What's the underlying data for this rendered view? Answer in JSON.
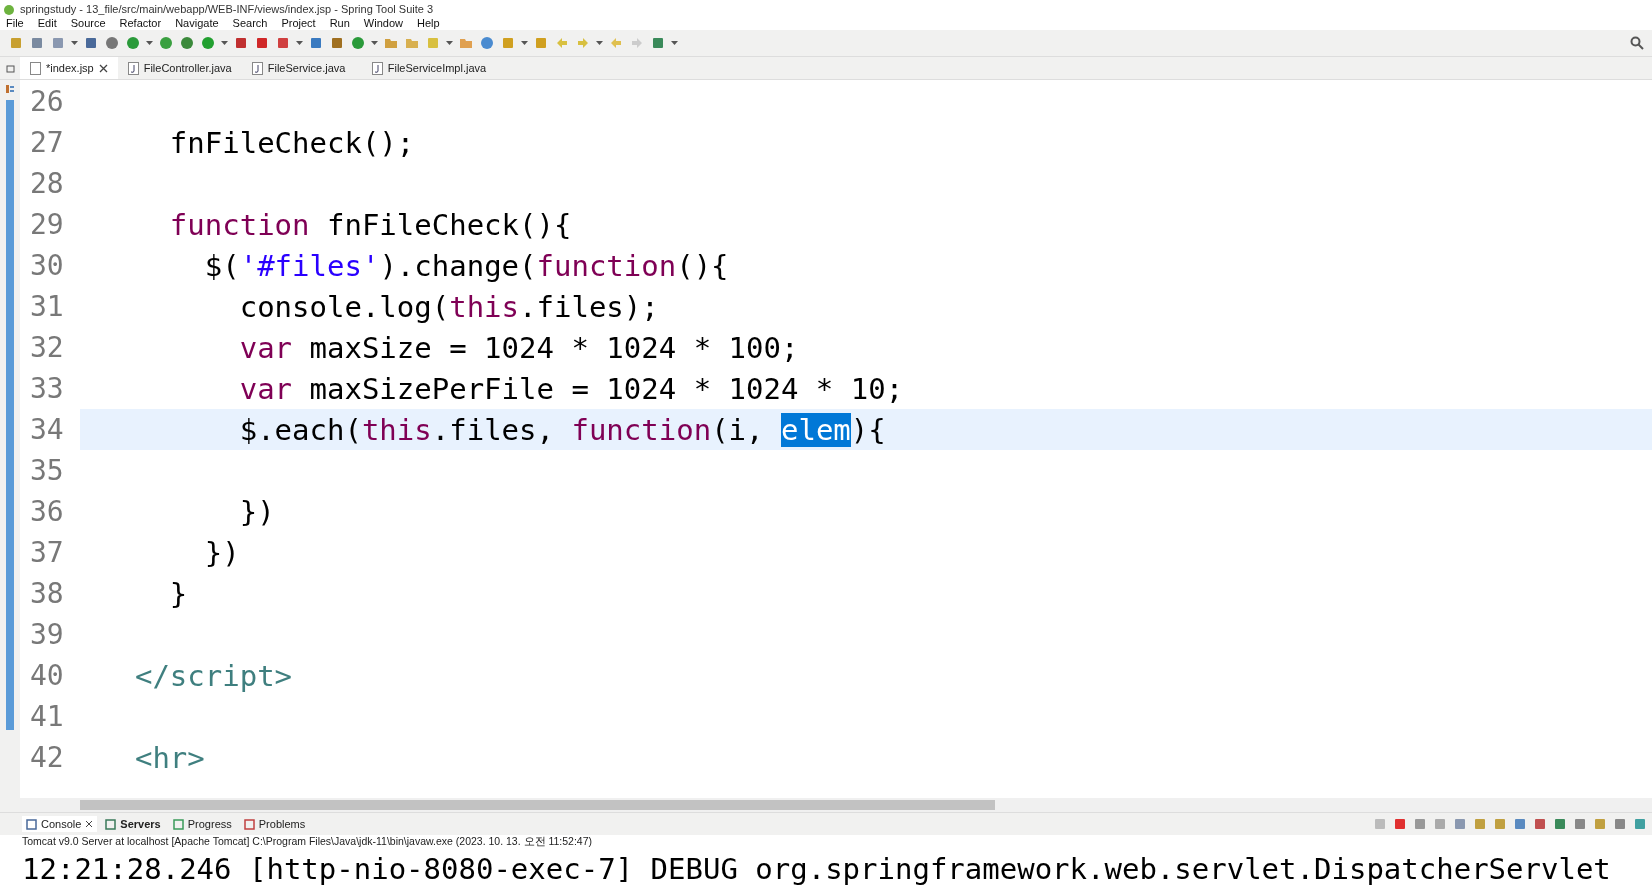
{
  "window": {
    "title": "springstudy - 13_file/src/main/webapp/WEB-INF/views/index.jsp - Spring Tool Suite 3"
  },
  "menu": [
    "File",
    "Edit",
    "Source",
    "Refactor",
    "Navigate",
    "Search",
    "Project",
    "Run",
    "Window",
    "Help"
  ],
  "editor_tabs": [
    {
      "label": "*index.jsp",
      "selected": true
    },
    {
      "label": "FileController.java",
      "selected": false
    },
    {
      "label": "FileService.java",
      "selected": false
    },
    {
      "label": "FileServiceImpl.java",
      "selected": false
    }
  ],
  "editor": {
    "lines": [
      {
        "number": "26",
        "current": false
      },
      {
        "number": "27",
        "current": false,
        "tokens": [
          {
            "text": "    fnFileCheck();",
            "kind": "plain"
          }
        ]
      },
      {
        "number": "28",
        "current": false
      },
      {
        "number": "29",
        "current": false,
        "tokens": [
          {
            "text": "    function",
            "kind": "keyword"
          },
          {
            "text": " fnFileCheck(){",
            "kind": "plain"
          }
        ]
      },
      {
        "number": "30",
        "current": false,
        "tokens": [
          {
            "text": "      $(",
            "kind": "plain"
          },
          {
            "text": "'#files'",
            "kind": "string"
          },
          {
            "text": ").change(",
            "kind": "plain"
          },
          {
            "text": "function",
            "kind": "keyword"
          },
          {
            "text": "(){",
            "kind": "plain"
          }
        ]
      },
      {
        "number": "31",
        "current": false,
        "tokens": [
          {
            "text": "        console.log(",
            "kind": "plain"
          },
          {
            "text": "this",
            "kind": "keyword"
          },
          {
            "text": ".files);",
            "kind": "plain"
          }
        ]
      },
      {
        "number": "32",
        "current": false,
        "tokens": [
          {
            "text": "        var",
            "kind": "keyword"
          },
          {
            "text": " maxSize = 1024 * 1024 * 100;",
            "kind": "plain"
          }
        ]
      },
      {
        "number": "33",
        "current": false,
        "tokens": [
          {
            "text": "        var",
            "kind": "keyword"
          },
          {
            "text": " maxSizePerFile = 1024 * 1024 * 10;",
            "kind": "plain"
          }
        ]
      },
      {
        "number": "34",
        "current": true,
        "tokens": [
          {
            "text": "        $.each(",
            "kind": "plain"
          },
          {
            "text": "this",
            "kind": "keyword"
          },
          {
            "text": ".files, ",
            "kind": "plain"
          },
          {
            "text": "function",
            "kind": "keyword"
          },
          {
            "text": "(i, ",
            "kind": "plain"
          },
          {
            "text": "elem",
            "kind": "selection"
          },
          {
            "text": "){",
            "kind": "plain"
          }
        ]
      },
      {
        "number": "35",
        "current": false
      },
      {
        "number": "36",
        "current": false,
        "tokens": [
          {
            "text": "        })",
            "kind": "plain"
          }
        ]
      },
      {
        "number": "37",
        "current": false,
        "tokens": [
          {
            "text": "      })",
            "kind": "plain"
          }
        ]
      },
      {
        "number": "38",
        "current": false,
        "tokens": [
          {
            "text": "    }",
            "kind": "plain"
          }
        ]
      },
      {
        "number": "39",
        "current": false
      },
      {
        "number": "40",
        "current": false,
        "tokens": [
          {
            "text": "  </script>",
            "kind": "tag"
          }
        ]
      },
      {
        "number": "41",
        "current": false
      },
      {
        "number": "42",
        "current": false,
        "tokens": [
          {
            "text": "  <hr>",
            "kind": "tag"
          }
        ]
      }
    ]
  },
  "bottom_tabs": [
    {
      "label": "Console",
      "selected": true
    },
    {
      "label": "Servers",
      "selected": false
    },
    {
      "label": "Progress",
      "selected": false
    },
    {
      "label": "Problems",
      "selected": false
    }
  ],
  "console": {
    "process": "Tomcat v9.0 Server at localhost [Apache Tomcat] C:\\Program Files\\Java\\jdk-11\\bin\\javaw.exe  (2023. 10. 13. 오전 11:52:47)",
    "output": "12:21:28.246 [http-nio-8080-exec-7] DEBUG org.springframework.web.servlet.DispatcherServlet"
  }
}
